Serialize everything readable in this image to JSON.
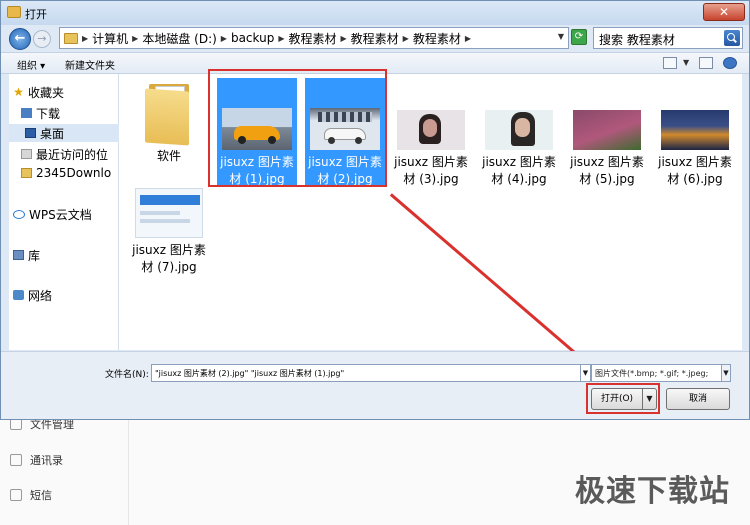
{
  "dialog": {
    "title": "打开",
    "close": "✕"
  },
  "nav": {
    "back": "←",
    "forward": "→"
  },
  "address": {
    "crumbs": [
      "计算机",
      "本地磁盘 (D:)",
      "backup",
      "教程素材",
      "教程素材",
      "教程素材"
    ]
  },
  "search": {
    "text": "搜索 教程素材"
  },
  "toolbar": {
    "organize": "组织",
    "new_folder": "新建文件夹"
  },
  "sidebar": {
    "items": [
      {
        "label": "收藏夹",
        "icon": "star-icon"
      },
      {
        "label": "下载",
        "icon": "download-icon"
      },
      {
        "label": "桌面",
        "icon": "desktop-icon",
        "selected": true
      },
      {
        "label": "最近访问的位",
        "icon": "recent-icon"
      },
      {
        "label": "2345Downlo",
        "icon": "folder-icon"
      },
      {
        "label": "WPS云文档",
        "icon": "cloud-icon"
      },
      {
        "label": "库",
        "icon": "library-icon"
      },
      {
        "label": "网络",
        "icon": "network-icon"
      }
    ]
  },
  "files": [
    {
      "name": "软件",
      "type": "folder"
    },
    {
      "name": "jisuxz 图片素材 (1).jpg",
      "selected": true,
      "colors": [
        "#c7d6e6",
        "#f0a010",
        "#222222"
      ]
    },
    {
      "name": "jisuxz 图片素材 (2).jpg",
      "selected": true,
      "colors": [
        "#dfe6ee",
        "#f7f7f7",
        "#333333"
      ]
    },
    {
      "name": "jisuxz 图片素材 (3).jpg",
      "colors": [
        "#e8e3e6",
        "#c99a8f",
        "#2a2020"
      ]
    },
    {
      "name": "jisuxz 图片素材 (4).jpg",
      "colors": [
        "#e9f0f2",
        "#d9b6a2",
        "#2a2626"
      ]
    },
    {
      "name": "jisuxz 图片素材 (5).jpg",
      "colors": [
        "#8a4a6a",
        "#b0587c",
        "#3d6b2e"
      ]
    },
    {
      "name": "jisuxz 图片素材 (6).jpg",
      "colors": [
        "#263a6e",
        "#d08a2c",
        "#1b2447"
      ]
    },
    {
      "name": "jisuxz 图片素材 (7).jpg",
      "colors": [
        "#f2f7fc",
        "#2f7fd8",
        "#ffffff"
      ]
    }
  ],
  "bottom": {
    "filename_label": "文件名(N):",
    "filename_value": "\"jisuxz 图片素材 (2).jpg\" \"jisuxz 图片素材 (1).jpg\"",
    "filetype": "图片文件(*.bmp; *.gif; *.jpeg;",
    "open_button": "打开(O)",
    "cancel_button": "取消"
  },
  "background_app": {
    "items": [
      "文件管理",
      "通讯录",
      "短信"
    ]
  },
  "watermark": "极速下载站"
}
